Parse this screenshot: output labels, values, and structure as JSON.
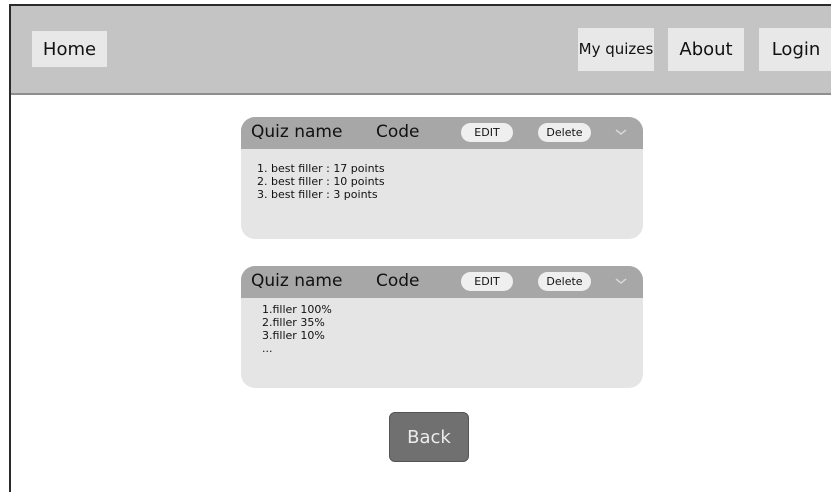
{
  "nav": {
    "home": "Home",
    "my_quizes": "My quizes",
    "about": "About",
    "login": "Login"
  },
  "quizzes": [
    {
      "name": "Quiz name",
      "code": "Code",
      "edit_label": "EDIT",
      "delete_label": "Delete",
      "expand_icon": "chevron-down-icon",
      "results": [
        "1. best filler : 17 points",
        "2. best filler : 10 points",
        "3. best filler :   3 points"
      ]
    },
    {
      "name": "Quiz name",
      "code": "Code",
      "edit_label": "EDIT",
      "delete_label": "Delete",
      "expand_icon": "chevron-down-icon",
      "results": [
        "1.filler 100%",
        "2.filler 35%",
        "3.filler 10%",
        "..."
      ]
    }
  ],
  "back_label": "Back",
  "colors": {
    "topbar": "#c4c4c4",
    "nav_button": "#e8e8e8",
    "card_header": "#a7a7a7",
    "card_body": "#e5e5e5",
    "back_button": "#707070"
  }
}
